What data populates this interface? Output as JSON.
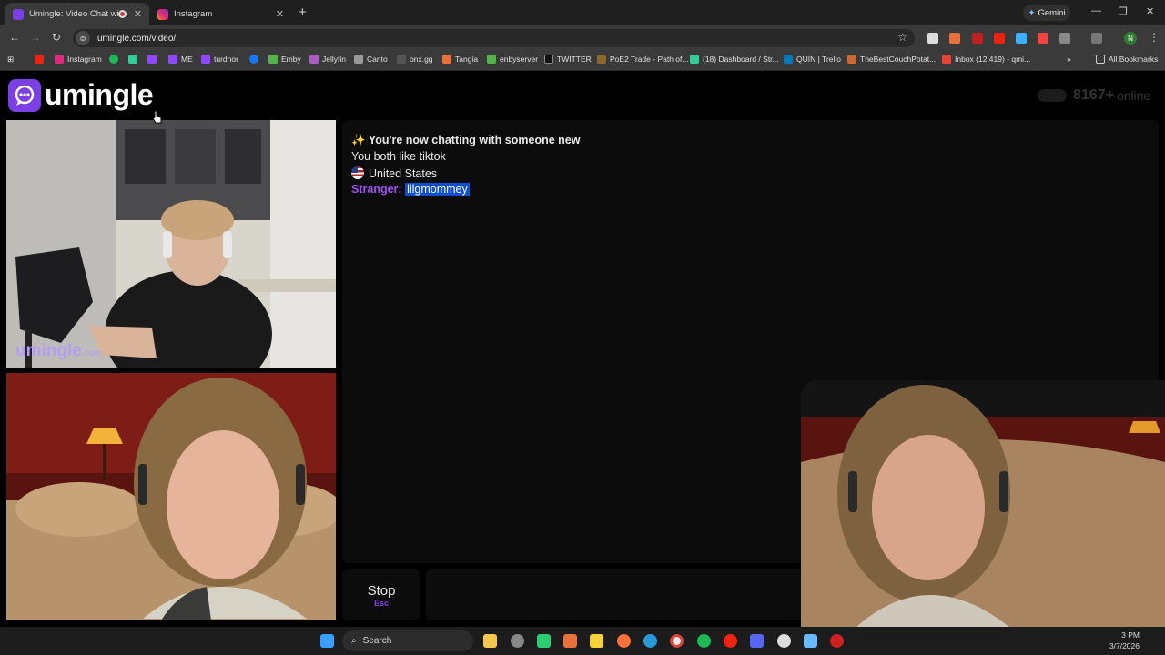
{
  "browser": {
    "tabs": [
      {
        "title": "Umingle: Video Chat with S"
      },
      {
        "title": "Instagram"
      }
    ],
    "gemini_label": "Gemini",
    "url": "umingle.com/video/",
    "profile_initial": "N",
    "bookmarks": [
      "Instagram",
      "ME",
      "turdnor",
      "Emby",
      "Jellyfin",
      "Canto",
      "onx.gg",
      "Tangia",
      "enbyserver",
      "TWITTER",
      "PoE2 Trade - Path of...",
      "(18) Dashboard / Str...",
      "QUIN | Trello",
      "TheBestCouchPotat...",
      "Inbox (12,419) - qmi..."
    ],
    "all_bookmarks": "All Bookmarks"
  },
  "site": {
    "logo_text": "umingle",
    "online_count": "8167+",
    "online_label": "online",
    "watermark_main": "umingle",
    "watermark_suffix": ".com"
  },
  "chat": {
    "intro": "You're now chatting with someone new",
    "intro_emoji": "✨",
    "interests": "You both like tiktok",
    "country": "United States",
    "stranger_label": "Stranger:",
    "stranger_handle": "lilgmommey"
  },
  "controls": {
    "stop_label": "Stop",
    "stop_shortcut": "Esc"
  },
  "taskbar": {
    "search_label": "Search",
    "time": "3 PM",
    "date": "3/7/2026"
  },
  "colors": {
    "brand_purple": "#7b3fe4",
    "stranger_label": "#a14ef3",
    "selection_blue": "#0e4fcf"
  }
}
